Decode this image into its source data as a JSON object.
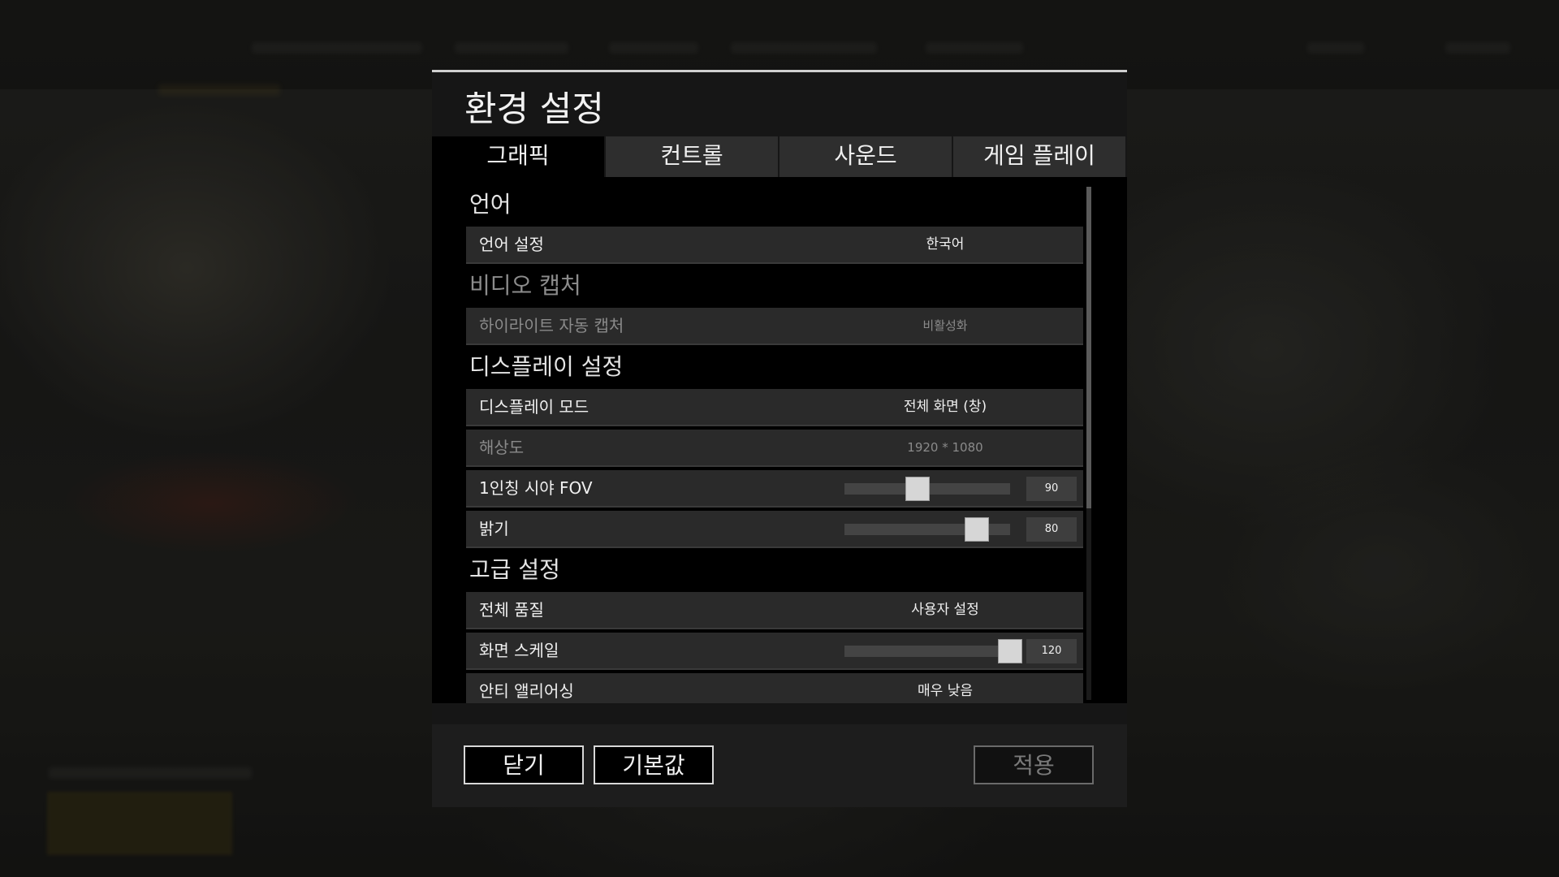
{
  "dialog": {
    "title": "환경 설정",
    "tabs": [
      {
        "label": "그래픽",
        "active": true
      },
      {
        "label": "컨트롤",
        "active": false
      },
      {
        "label": "사운드",
        "active": false
      },
      {
        "label": "게임 플레이",
        "active": false
      }
    ]
  },
  "sections": {
    "language": {
      "heading": "언어",
      "language_setting": {
        "label": "언어 설정",
        "value": "한국어"
      }
    },
    "video_capture": {
      "heading": "비디오 캡처",
      "highlight_capture": {
        "label": "하이라이트 자동 캡처",
        "value": "비활성화"
      }
    },
    "display": {
      "heading": "디스플레이 설정",
      "display_mode": {
        "label": "디스플레이 모드",
        "value": "전체 화면 (창)"
      },
      "resolution": {
        "label": "해상도",
        "value": "1920 * 1080"
      },
      "fov": {
        "label": "1인칭 시야 FOV",
        "value": "90",
        "fraction": 0.44
      },
      "brightness": {
        "label": "밝기",
        "value": "80",
        "fraction": 0.8
      }
    },
    "advanced": {
      "heading": "고급 설정",
      "overall_quality": {
        "label": "전체 품질",
        "value": "사용자 설정"
      },
      "screen_scale": {
        "label": "화면 스케일",
        "value": "120",
        "fraction": 1.0
      },
      "anti_aliasing": {
        "label": "안티 앨리어싱",
        "value": "매우 낮음"
      }
    }
  },
  "footer": {
    "close_label": "닫기",
    "default_label": "기본값",
    "apply_label": "적용"
  },
  "colors": {
    "panel": "#161616",
    "row": "#2a2a2a",
    "active_tab": "#000000"
  }
}
